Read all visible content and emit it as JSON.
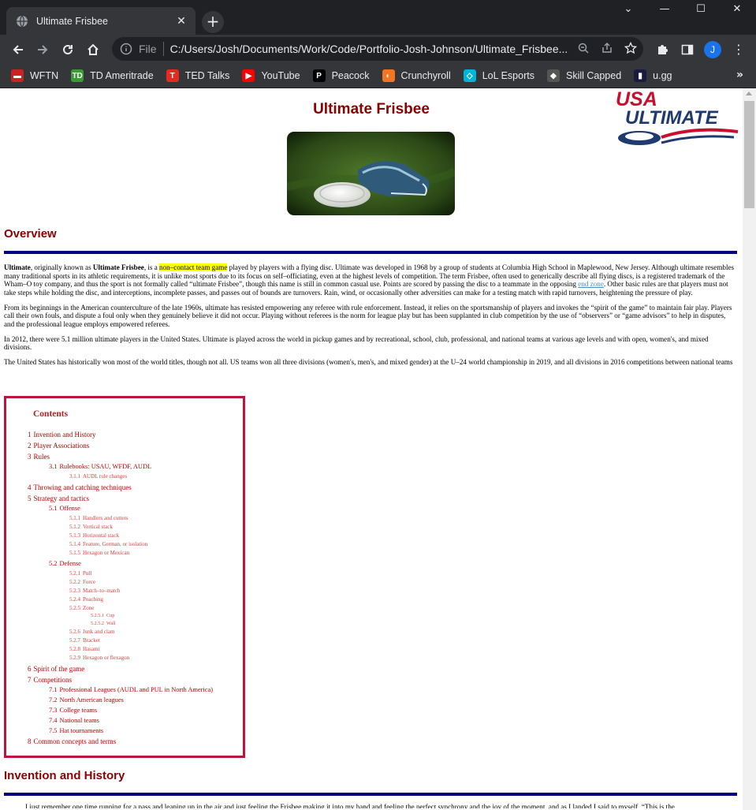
{
  "browser": {
    "tab_title": "Ultimate Frisbee",
    "url_scheme": "File",
    "url": "C:/Users/Josh/Documents/Work/Code/Portfolio-Josh-Johnson/Ultimate_Frisbee...",
    "profile_initial": "J",
    "bookmarks": [
      {
        "label": "WFTN",
        "icon": "wftn-icon",
        "color": "#cc2222"
      },
      {
        "label": "TD Ameritrade",
        "icon": "td-icon",
        "color": "#3a9c35"
      },
      {
        "label": "TED Talks",
        "icon": "ted-icon",
        "color": "#e62b1e"
      },
      {
        "label": "YouTube",
        "icon": "youtube-icon",
        "color": "#ff0000"
      },
      {
        "label": "Peacock",
        "icon": "peacock-icon",
        "color": "#000000"
      },
      {
        "label": "Crunchyroll",
        "icon": "crunchyroll-icon",
        "color": "#f47521"
      },
      {
        "label": "LoL Esports",
        "icon": "lol-esports-icon",
        "color": "#00b4d8"
      },
      {
        "label": "Skill Capped",
        "icon": "skill-capped-icon",
        "color": "#555555"
      },
      {
        "label": "u.gg",
        "icon": "ugg-icon",
        "color": "#1a1a40"
      }
    ],
    "more_bookmarks": "»"
  },
  "page": {
    "title": "Ultimate Frisbee",
    "logo_text_1": "USA",
    "logo_text_2": "ULTIMATE",
    "overview_heading": "Overview",
    "p1_a": "Ultimate",
    "p1_b": ", originally known as ",
    "p1_c": "Ultimate Frisbee",
    "p1_d": ", is a ",
    "p1_highlight": "non–contact team game",
    "p1_e": " played by players with a flying disc. Ultimate was developed in 1968 by a group of students at Columbia High School in Maplewood, New Jersey. Although ultimate resembles many traditional sports in its athletic requirements, it is unlike most sports due to its focus on self–officiating, even at the highest levels of competition. The term Frisbee, often used to generically describe all flying discs, is a registered trademark of the Wham–O toy company, and thus the sport is not formally called “ultimate Frisbee”, though this name is still in common casual use. Points are scored by passing the disc to a teammate in the opposing ",
    "p1_link": "end zone",
    "p1_f": ". Other basic rules are that players must not take steps while holding the disc, and interceptions, incomplete passes, and passes out of bounds are turnovers. Rain, wind, or occasionally other adversities can make for a testing match with rapid turnovers, heightening the pressure of play.",
    "p2": "From its beginnings in the American counterculture of the late 1960s, ultimate has resisted empowering any referee with rule enforcement. Instead, it relies on the sportsmanship of players and invokes the “spirit of the game” to maintain fair play. Players call their own fouls, and dispute a foul only when they genuinely believe it did not occur. Playing without referees is the norm for league play but has been supplanted in club competition by the use of “observers” or “game advisors” to help in disputes, and the professional league employs empowered referees.",
    "p3": "In 2012, there were 5.1 million ultimate players in the United States. Ultimate is played across the world in pickup games and by recreational, school, club, professional, and national teams at various age levels and with open, women's, and mixed divisions.",
    "p4": "The United States has historically won most of the world titles, though not all. US teams won all three divisions (women's, men's, and mixed gender) at the U–24 world championship in 2019, and all divisions in 2016 competitions between national teams",
    "contents_title": "Contents",
    "toc": [
      {
        "n": "1",
        "t": "Invention and History",
        "lv": 1
      },
      {
        "n": "2",
        "t": "Player Associations",
        "lv": 1
      },
      {
        "n": "3",
        "t": "Rules",
        "lv": 1
      },
      {
        "n": "3.1",
        "t": "Rulebooks: USAU, WFDF, AUDL",
        "lv": 2
      },
      {
        "n": "3.1.1",
        "t": "AUDL rule changes",
        "lv": 3
      },
      {
        "n": "4",
        "t": "Throwing and catching techniques",
        "lv": 1
      },
      {
        "n": "5",
        "t": "Strategy and tactics",
        "lv": 1
      },
      {
        "n": "5.1",
        "t": "Offense",
        "lv": 2
      },
      {
        "n": "5.1.1",
        "t": "Handlers and cutters",
        "lv": 3
      },
      {
        "n": "5.1.2",
        "t": "Vertical stack",
        "lv": 3
      },
      {
        "n": "5.1.3",
        "t": "Horizontal stack",
        "lv": 3
      },
      {
        "n": "5.1.4",
        "t": "Feature, German, or isolation",
        "lv": 3
      },
      {
        "n": "5.1.5",
        "t": "Hexagon or Mexican",
        "lv": 3
      },
      {
        "n": "5.2",
        "t": "Defense",
        "lv": 2
      },
      {
        "n": "5.2.1",
        "t": "Pull",
        "lv": 3
      },
      {
        "n": "5.2.2",
        "t": "Force",
        "lv": 3
      },
      {
        "n": "5.2.3",
        "t": "Match–to–match",
        "lv": 3
      },
      {
        "n": "5.2.4",
        "t": "Poaching",
        "lv": 3
      },
      {
        "n": "5.2.5",
        "t": "Zone",
        "lv": 3
      },
      {
        "n": "5.2.5.1",
        "t": "Cup",
        "lv": 4
      },
      {
        "n": "5.2.5.2",
        "t": "Wall",
        "lv": 4
      },
      {
        "n": "5.2.6",
        "t": "Junk and clam",
        "lv": 3
      },
      {
        "n": "5.2.7",
        "t": "Bracket",
        "lv": 3
      },
      {
        "n": "5.2.8",
        "t": "Hasami",
        "lv": 3
      },
      {
        "n": "5.2.9",
        "t": "Hexagon or flexagon",
        "lv": 3
      },
      {
        "n": "6",
        "t": "Spirit of the game",
        "lv": 1
      },
      {
        "n": "7",
        "t": "Competitions",
        "lv": 1
      },
      {
        "n": "7.1",
        "t": "Professional Leagues (AUDL and PUL in North America)",
        "lv": 2
      },
      {
        "n": "7.2",
        "t": "North American leagues",
        "lv": 2
      },
      {
        "n": "7.3",
        "t": "College teams",
        "lv": 2
      },
      {
        "n": "7.4",
        "t": "National teams",
        "lv": 2
      },
      {
        "n": "7.5",
        "t": "Hat tournaments",
        "lv": 2
      },
      {
        "n": "8",
        "t": "Common concepts and terms",
        "lv": 1
      }
    ],
    "history_heading": "Invention and History",
    "history_quote": "I just remember one time running for a pass and leaping up in the air and just feeling the Frisbee making it into my hand and feeling the perfect synchrony and the joy of the moment, and as I landed I said to myself, “This is the"
  }
}
